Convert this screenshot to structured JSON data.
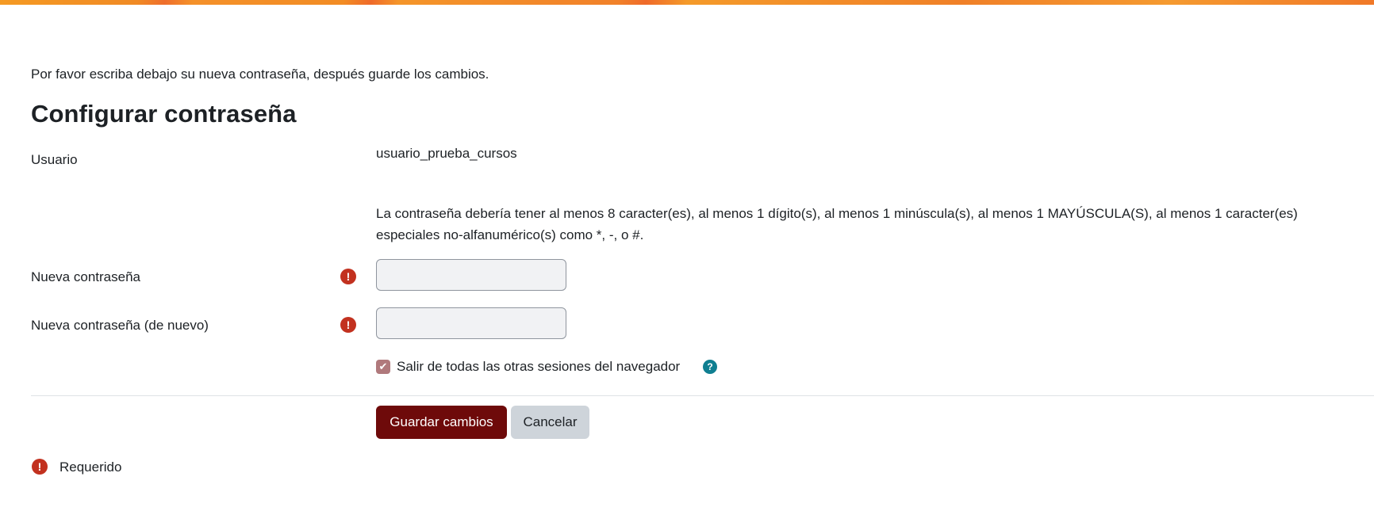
{
  "intro_text": "Por favor escriba debajo su nueva contraseña, después guarde los cambios.",
  "title": "Configurar contraseña",
  "fields": {
    "username": {
      "label": "Usuario",
      "value": "usuario_prueba_cursos"
    },
    "password_hint": "La contraseña debería tener al menos 8 caracter(es), al menos 1 dígito(s), al menos 1 minúscula(s), al menos 1 MAYÚSCULA(S), al menos 1 caracter(es) especiales no-alfanumérico(s) como *, -, o #.",
    "new_password": {
      "label": "Nueva contraseña",
      "value": ""
    },
    "new_password_again": {
      "label": "Nueva contraseña (de nuevo)",
      "value": ""
    }
  },
  "logout_others": {
    "label": "Salir de todas las otras sesiones del navegador",
    "checked": true
  },
  "buttons": {
    "save": "Guardar cambios",
    "cancel": "Cancelar"
  },
  "required_legend": "Requerido",
  "icons": {
    "required": "exclamation-circle-icon",
    "help": "question-circle-icon",
    "checkbox": "check-icon"
  },
  "colors": {
    "primary": "#6e0a0a",
    "required": "#c2311f",
    "help": "#0f7f91",
    "checkbox": "#b0797c"
  }
}
